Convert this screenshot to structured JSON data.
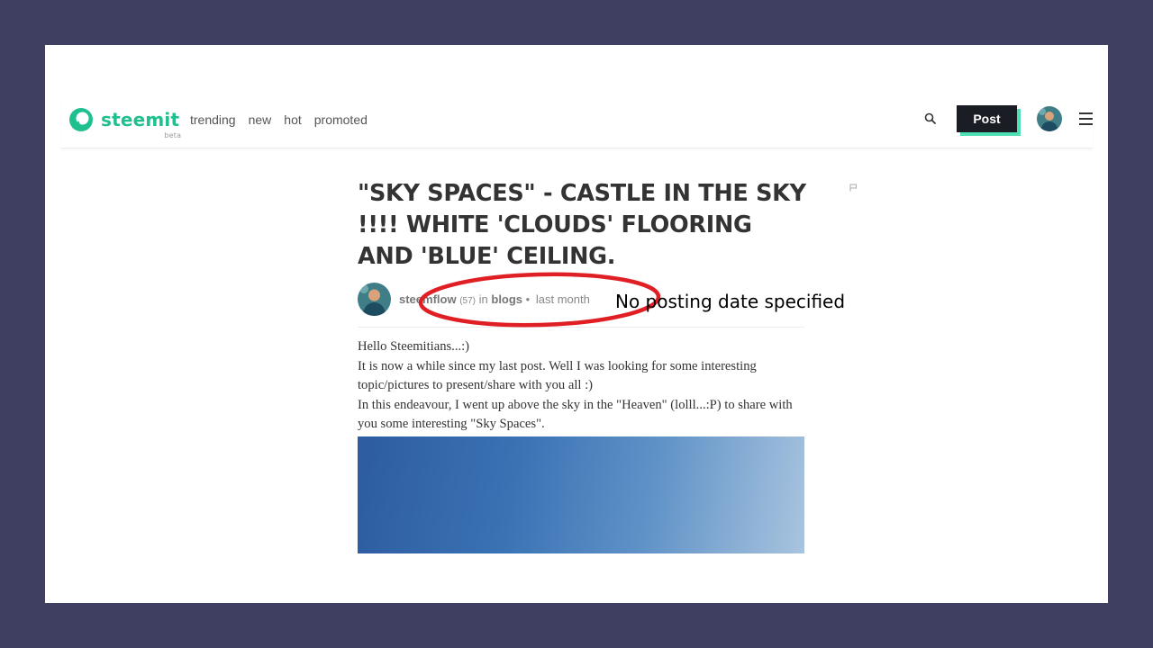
{
  "colors": {
    "background": "#3e3f61",
    "brand": "#1fbf8f",
    "post_button": "#1a1d24",
    "post_button_shadow": "#4ee0b4",
    "annotation": "#e01f24"
  },
  "header": {
    "logo_text": "steemit",
    "logo_badge": "beta",
    "logo_icon": "steemit-logo-icon",
    "nav": [
      "trending",
      "new",
      "hot",
      "promoted"
    ],
    "search_icon": "search-icon",
    "post_label": "Post",
    "menu_icon": "hamburger-menu-icon"
  },
  "article": {
    "title": "\"SKY SPACES\" - CASTLE IN THE SKY !!!! WHITE 'CLOUDS' FLOORING AND 'BLUE' CEILING.",
    "author": "steemflow",
    "reputation": "(57)",
    "in_label": "in",
    "category": "blogs",
    "separator": "•",
    "posted": "last month",
    "paragraphs": [
      "Hello Steemitians...:)",
      "It is now a while since my last post. Well I was looking for some interesting topic/pictures to present/share with you all :)",
      "In this endeavour, I went up above the sky in the \"Heaven\" (lolll...:P) to share with you some interesting \"Sky Spaces\"."
    ]
  },
  "annotation": {
    "text": "No posting date specified"
  }
}
